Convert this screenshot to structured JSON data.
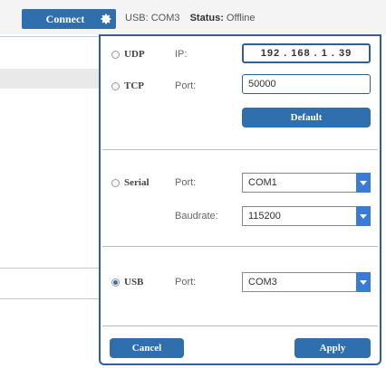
{
  "topbar": {
    "connect_label": "Connect",
    "usb_text": "USB: COM3",
    "status_label": "Status:",
    "status_value": "Offline"
  },
  "network": {
    "udp_label": "UDP",
    "tcp_label": "TCP",
    "ip_label": "IP:",
    "ip_value": "192 . 168 .  1  . 39",
    "port_label": "Port:",
    "port_value": "50000",
    "default_label": "Default"
  },
  "serial": {
    "label": "Serial",
    "port_label": "Port:",
    "port_value": "COM1",
    "baud_label": "Baudrate:",
    "baud_value": "115200"
  },
  "usb": {
    "label": "USB",
    "port_label": "Port:",
    "port_value": "COM3",
    "selected": true
  },
  "footer": {
    "cancel_label": "Cancel",
    "apply_label": "Apply"
  },
  "colors": {
    "accent": "#2f6fad",
    "dropdown_arrow": "#3a7bd5",
    "panel_border": "#2f5f95"
  },
  "icons": {
    "settings": "gear-icon",
    "dropdown": "chevron-down-icon"
  }
}
